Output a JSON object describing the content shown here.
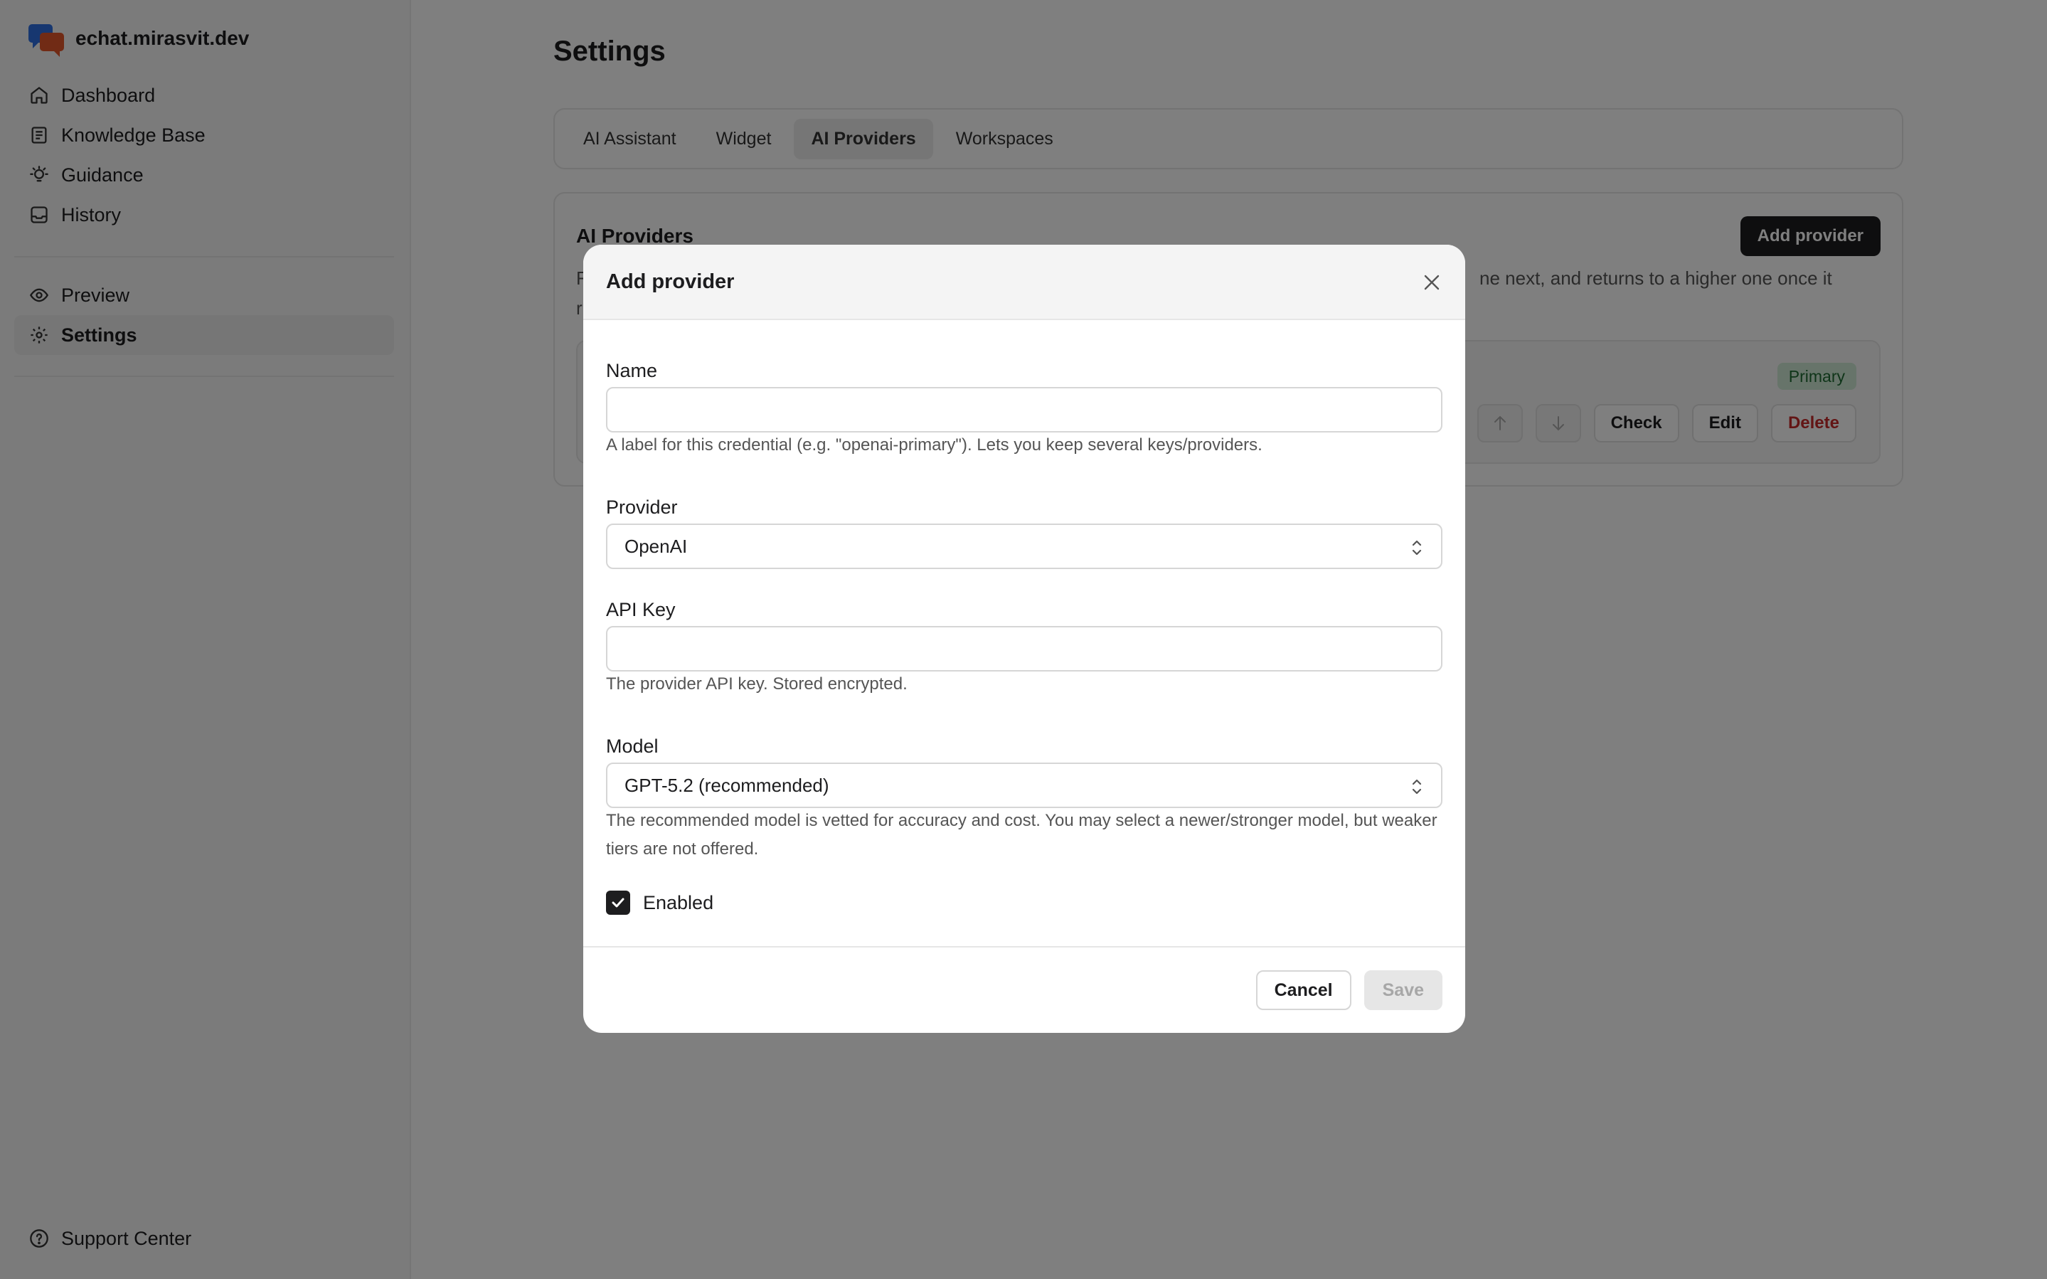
{
  "sidebar": {
    "brand": "echat.mirasvit.dev",
    "items_primary": [
      {
        "label": "Dashboard",
        "icon": "home-icon"
      },
      {
        "label": "Knowledge Base",
        "icon": "notebook-icon"
      },
      {
        "label": "Guidance",
        "icon": "lightbulb-icon"
      },
      {
        "label": "History",
        "icon": "inbox-icon"
      }
    ],
    "items_secondary": [
      {
        "label": "Preview",
        "icon": "eye-icon"
      },
      {
        "label": "Settings",
        "icon": "gear-icon",
        "active": true
      }
    ],
    "support": {
      "label": "Support Center",
      "icon": "help-circle-icon"
    }
  },
  "main": {
    "title": "Settings",
    "tabs": [
      {
        "label": "AI Assistant"
      },
      {
        "label": "Widget"
      },
      {
        "label": "AI Providers",
        "active": true
      },
      {
        "label": "Workspaces"
      }
    ],
    "providers_card": {
      "title": "AI Providers",
      "description_line1_start": "F",
      "description_line1_end": "ne next, and returns to a higher one once it",
      "description_line2_start": "r",
      "add_button": "Add provider",
      "row": {
        "badge": "Primary",
        "check": "Check",
        "edit": "Edit",
        "delete": "Delete"
      }
    }
  },
  "modal": {
    "title": "Add provider",
    "name": {
      "label": "Name",
      "value": "",
      "help": "A label for this credential (e.g. \"openai-primary\"). Lets you keep several keys/providers."
    },
    "provider": {
      "label": "Provider",
      "selected": "OpenAI"
    },
    "api_key": {
      "label": "API Key",
      "value": "",
      "help": "The provider API key. Stored encrypted."
    },
    "model": {
      "label": "Model",
      "selected": "GPT-5.2 (recommended)",
      "help": "The recommended model is vetted for accuracy and cost. You may select a newer/stronger model, but weaker tiers are not offered."
    },
    "enabled": {
      "label": "Enabled",
      "checked": true
    },
    "cancel": "Cancel",
    "save": "Save"
  },
  "colors": {
    "primary_dark": "#1d1d1f",
    "danger": "#c62b2b",
    "badge_bg": "#cfe9d4",
    "badge_text": "#1f6b33",
    "overlay": "rgba(0,0,0,0.5)"
  }
}
